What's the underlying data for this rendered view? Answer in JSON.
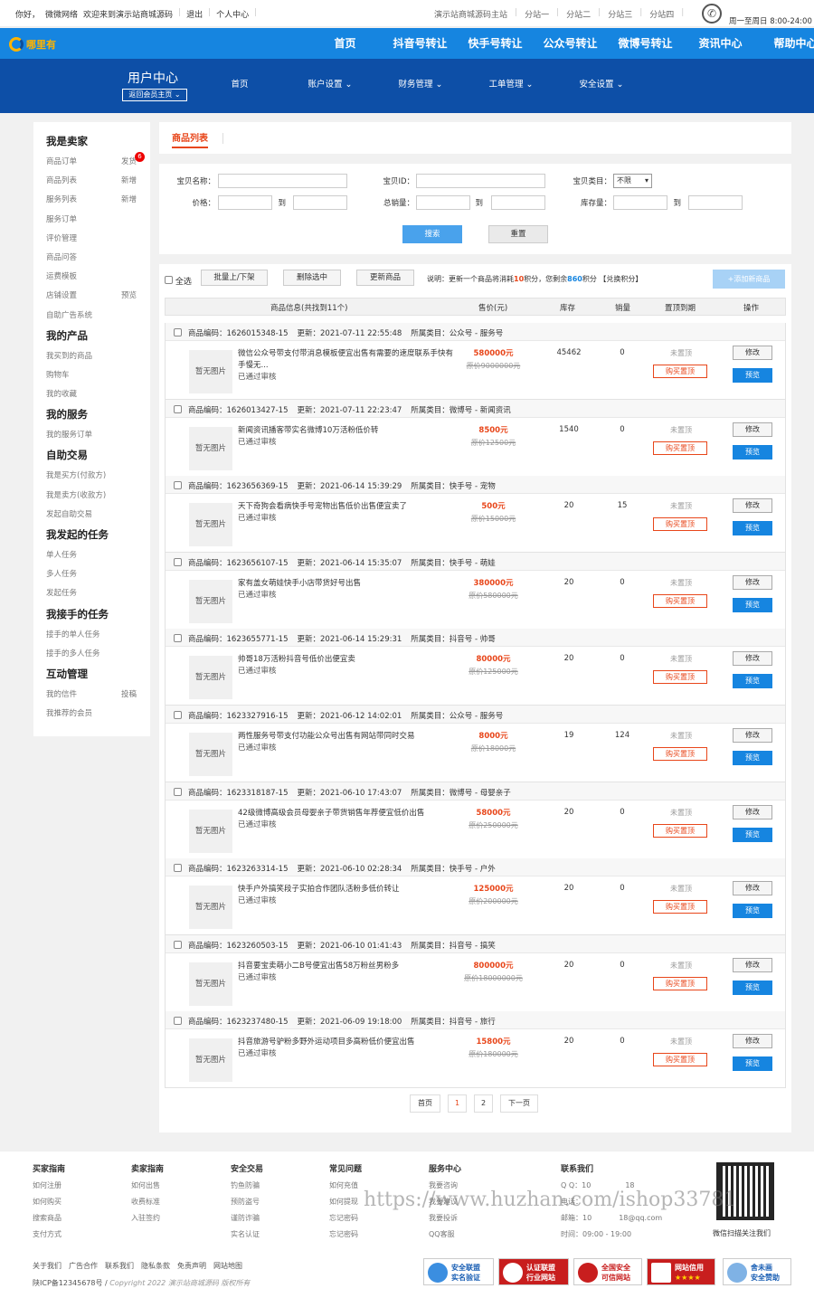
{
  "topbar": {
    "greeting": "你好，",
    "user": "微微网络",
    "welcome": "欢迎来到演示站商城源码",
    "logout": "退出",
    "center": "个人中心",
    "main_site": "演示站商城源码主站",
    "sites": [
      "分站一",
      "分站二",
      "分站三",
      "分站四"
    ],
    "hours": "周一至周日 8:00-24:00"
  },
  "logo": {
    "text": "哪里有"
  },
  "nav": [
    "首页",
    "抖音号转让",
    "快手号转让",
    "公众号转让",
    "微博号转让",
    "资讯中心",
    "帮助中心"
  ],
  "subnav": {
    "title": "用户中心",
    "back": "返回会员主页",
    "items": [
      "首页",
      "账户设置",
      "财务管理",
      "工单管理",
      "安全设置"
    ]
  },
  "sidebar": [
    {
      "title": "我是卖家",
      "items": [
        {
          "label": "商品订单",
          "right": "发货",
          "badge": "6"
        },
        {
          "label": "商品列表",
          "right": "新增"
        },
        {
          "label": "服务列表",
          "right": "新增"
        },
        {
          "label": "服务订单"
        },
        {
          "label": "评价管理"
        },
        {
          "label": "商品问答"
        },
        {
          "label": "运费模板"
        },
        {
          "label": "店铺设置",
          "right": "预览"
        },
        {
          "label": "自助广告系统"
        }
      ]
    },
    {
      "title": "我的产品",
      "items": [
        {
          "label": "我买到的商品"
        },
        {
          "label": "购物车"
        },
        {
          "label": "我的收藏"
        }
      ]
    },
    {
      "title": "我的服务",
      "items": [
        {
          "label": "我的服务订单"
        }
      ]
    },
    {
      "title": "自助交易",
      "items": [
        {
          "label": "我是买方(付款方)"
        },
        {
          "label": "我是卖方(收款方)"
        },
        {
          "label": "发起自助交易"
        }
      ]
    },
    {
      "title": "我发起的任务",
      "items": [
        {
          "label": "单人任务"
        },
        {
          "label": "多人任务"
        },
        {
          "label": "发起任务"
        }
      ]
    },
    {
      "title": "我接手的任务",
      "items": [
        {
          "label": "接手的单人任务"
        },
        {
          "label": "接手的多人任务"
        }
      ]
    },
    {
      "title": "互动管理",
      "items": [
        {
          "label": "我的信件",
          "right": "投稿"
        },
        {
          "label": "我推荐的会员"
        }
      ]
    }
  ],
  "tab": "商品列表",
  "filter": {
    "name": "宝贝名称：",
    "id": "宝贝ID：",
    "cat": "宝贝类目：",
    "cat_value": "不限",
    "price": "价格：",
    "sales": "总销量：",
    "stock": "库存量：",
    "to": "到",
    "search": "搜索",
    "reset": "重置"
  },
  "toolbar": {
    "all": "全选",
    "onoff": "批量上/下架",
    "del": "删除选中",
    "update": "更新商品",
    "note_a": "说明：更新一个商品将消耗",
    "cost": "10",
    "note_b": "积分，您剩余",
    "left": "860",
    "note_c": "积分",
    "exchange": "【兑换积分】",
    "add": "+添加新商品"
  },
  "columns": [
    "商品信息(共找到11个)",
    "售价(元)",
    "库存",
    "销量",
    "置顶到期",
    "操作"
  ],
  "labels": {
    "code": "商品编码：",
    "upd": "更新：",
    "cat": "所属类目：",
    "noimg": "暂无图片",
    "audit": "已通过审核",
    "top": "未置顶",
    "buy": "购买置顶",
    "edit": "修改",
    "preview": "预览"
  },
  "products": [
    {
      "code": "1626015348-15",
      "time": "2021-07-11 22:55:48",
      "cat": "公众号 - 服务号",
      "title": "微信公众号带支付带消息模板便宜出售有需要的速度联系手快有手慢无...",
      "price": "580000元",
      "orig": "原价9000000元",
      "stock": "45462",
      "sales": "0"
    },
    {
      "code": "1626013427-15",
      "time": "2021-07-11 22:23:47",
      "cat": "微博号 - 新闻资讯",
      "title": "新闻资讯播客带实名微博10万活粉低价转",
      "price": "8500元",
      "orig": "原价12500元",
      "stock": "1540",
      "sales": "0"
    },
    {
      "code": "1623656369-15",
      "time": "2021-06-14 15:39:29",
      "cat": "快手号 - 宠物",
      "title": "天下奇狗会看病快手号宠物出售低价出售便宜卖了",
      "price": "500元",
      "orig": "原价15000元",
      "stock": "20",
      "sales": "15"
    },
    {
      "code": "1623656107-15",
      "time": "2021-06-14 15:35:07",
      "cat": "快手号 - 萌娃",
      "title": "家有盖女萌娃快手小店带货好号出售",
      "price": "380000元",
      "orig": "原价580000元",
      "stock": "20",
      "sales": "0"
    },
    {
      "code": "1623655771-15",
      "time": "2021-06-14 15:29:31",
      "cat": "抖音号 - 帅哥",
      "title": "帅哥18万活粉抖音号低价出便宜卖",
      "price": "80000元",
      "orig": "原价125000元",
      "stock": "20",
      "sales": "0"
    },
    {
      "code": "1623327916-15",
      "time": "2021-06-12 14:02:01",
      "cat": "公众号 - 服务号",
      "title": "两性服务号带支付功能公众号出售有网站带同时交易",
      "price": "8000元",
      "orig": "原价18000元",
      "stock": "19",
      "sales": "124"
    },
    {
      "code": "1623318187-15",
      "time": "2021-06-10 17:43:07",
      "cat": "微博号 - 母婴亲子",
      "title": "42级微博高级会员母婴亲子带货销售年荐便宜低价出售",
      "price": "58000元",
      "orig": "原价250000元",
      "stock": "20",
      "sales": "0"
    },
    {
      "code": "1623263314-15",
      "time": "2021-06-10 02:28:34",
      "cat": "快手号 - 户外",
      "title": "快手户外搞笑段子实拍合作团队活粉多低价转让",
      "price": "125000元",
      "orig": "原价200000元",
      "stock": "20",
      "sales": "0"
    },
    {
      "code": "1623260503-15",
      "time": "2021-06-10 01:41:43",
      "cat": "抖音号 - 搞笑",
      "title": "抖音要宝卖萌小二B号便宜出售58万粉丝男粉多",
      "price": "800000元",
      "orig": "原价18000000元",
      "stock": "20",
      "sales": "0"
    },
    {
      "code": "1623237480-15",
      "time": "2021-06-09 19:18:00",
      "cat": "抖音号 - 旅行",
      "title": "抖音旅游号驴粉多野外运动项目多高粉低价便宜出售",
      "price": "15800元",
      "orig": "原价180000元",
      "stock": "20",
      "sales": "0"
    }
  ],
  "pager": {
    "first": "首页",
    "p1": "1",
    "p2": "2",
    "next": "下一页"
  },
  "footer": {
    "cols": [
      {
        "title": "买家指南",
        "items": [
          "如何注册",
          "如何购买",
          "搜索商品",
          "支付方式"
        ]
      },
      {
        "title": "卖家指南",
        "items": [
          "如何出售",
          "收费标准",
          "入驻签约"
        ]
      },
      {
        "title": "安全交易",
        "items": [
          "钓鱼防骗",
          "预防盗号",
          "谨防诈骗",
          "实名认证"
        ]
      },
      {
        "title": "常见问题",
        "items": [
          "如何充值",
          "如何提现",
          "忘记密码",
          "忘记密码"
        ]
      },
      {
        "title": "服务中心",
        "items": [
          "我要咨询",
          "我要建议",
          "我要投诉",
          "QQ客服"
        ]
      }
    ],
    "contact": {
      "title": "联系我们",
      "qq": "Q Q：10",
      "qq2": "18",
      "tel": "电话：",
      "mail": "邮箱：10",
      "mail2": "18@qq.com",
      "time": "时间：09:00 - 19:00"
    },
    "qr_text": "微信扫描关注我们",
    "watermark": "https://www.huzhan.com/ishop33781",
    "links": [
      "关于我们",
      "广告合作",
      "联系我们",
      "隐私条款",
      "免责声明",
      "网站地图"
    ],
    "icp": "陕ICP备12345678号",
    "copyright": "Copyright 2022 演示站商城源码 版权所有",
    "badges": [
      {
        "a": "安全联盟",
        "b": "实名验证"
      },
      {
        "a": "认证联盟",
        "b": "行业网站"
      },
      {
        "a": "全国安全",
        "b": "可信网站"
      },
      {
        "a": "网站信用",
        "b": "★★★★"
      },
      {
        "a": "舍未画",
        "b": "安全赞助"
      }
    ]
  }
}
